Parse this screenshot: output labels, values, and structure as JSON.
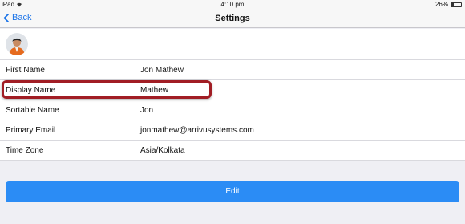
{
  "status_bar": {
    "device": "iPad",
    "time": "4:10 pm",
    "battery": "26%",
    "battery_level": 0.26
  },
  "nav": {
    "back_label": "Back",
    "title": "Settings"
  },
  "profile": {
    "fields": [
      {
        "label": "First Name",
        "value": "Jon Mathew"
      },
      {
        "label": "Display Name",
        "value": "Mathew"
      },
      {
        "label": "Sortable Name",
        "value": "Jon"
      },
      {
        "label": "Primary Email",
        "value": "jonmathew@arrivusystems.com"
      },
      {
        "label": "Time Zone",
        "value": "Asia/Kolkata"
      }
    ]
  },
  "actions": {
    "edit_label": "Edit"
  },
  "colors": {
    "accent": "#2b8cf5",
    "highlight": "#a11d24"
  }
}
